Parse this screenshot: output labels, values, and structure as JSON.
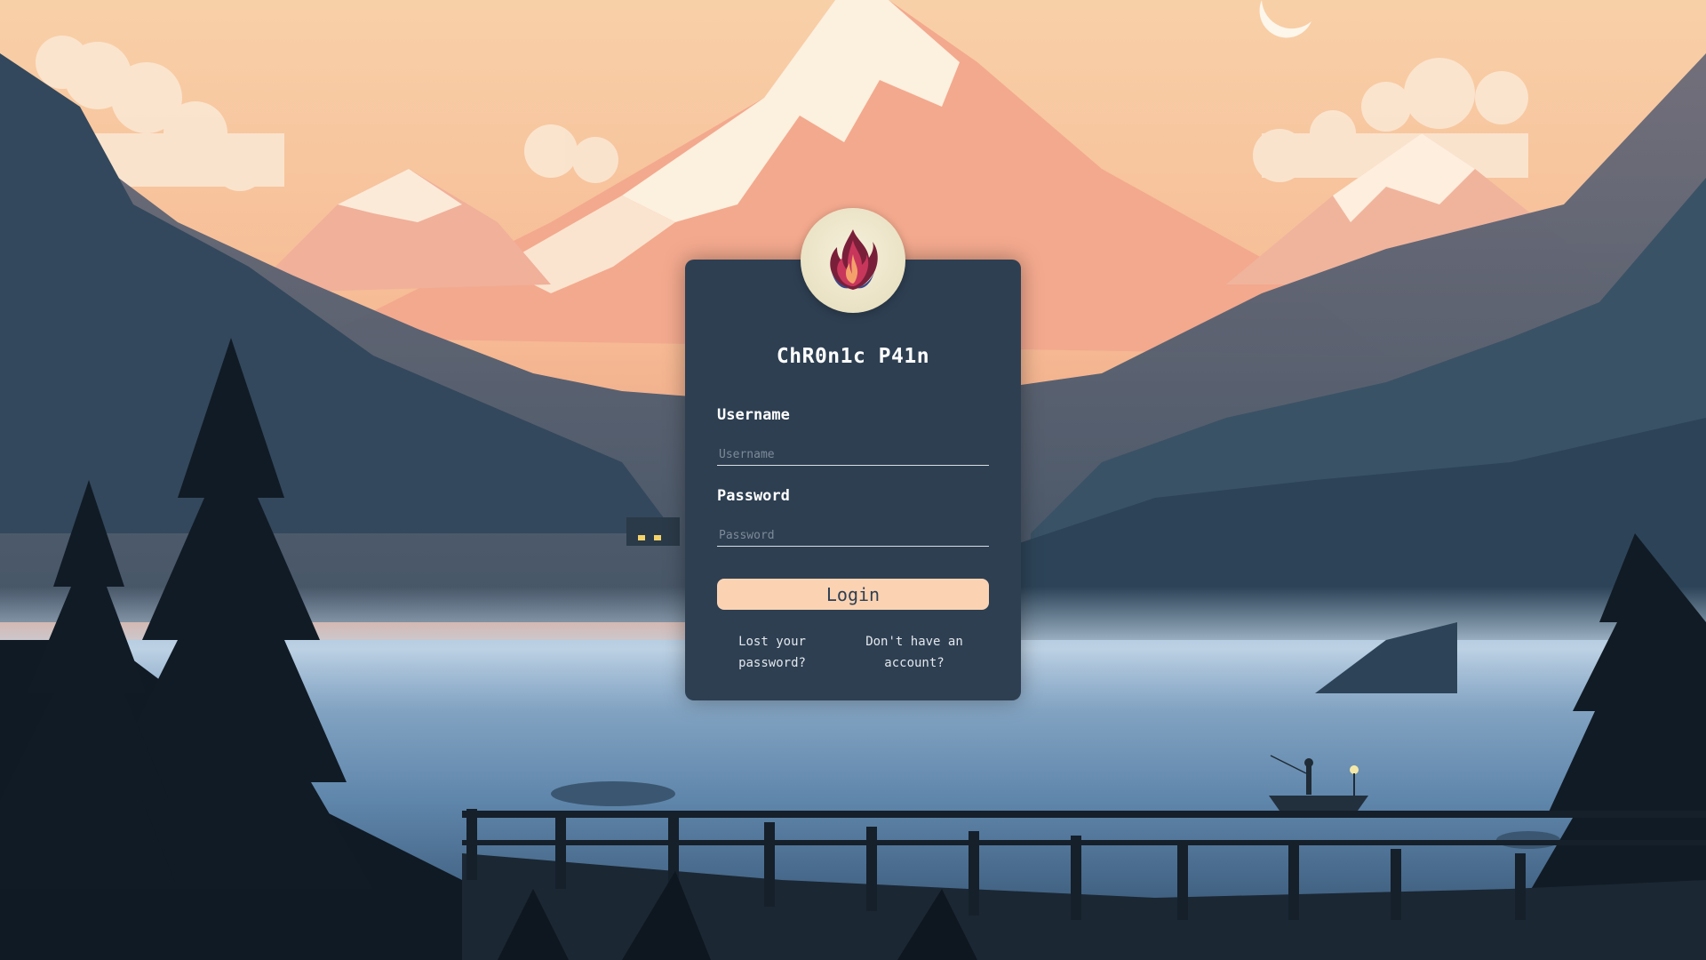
{
  "app": {
    "title": "ChR0n1c P41n"
  },
  "form": {
    "username_label": "Username",
    "username_placeholder": "Username",
    "username_value": "",
    "password_label": "Password",
    "password_placeholder": "Password",
    "password_value": "",
    "login_label": "Login"
  },
  "links": {
    "lost_password": "Lost your password?",
    "register": "Don't have an account?"
  },
  "icons": {
    "logo": "flame-icon"
  },
  "colors": {
    "card": "#2e3f52",
    "button": "#fbd3b3",
    "sky": "#f4b896",
    "logo_circle": "#eee6c9"
  }
}
